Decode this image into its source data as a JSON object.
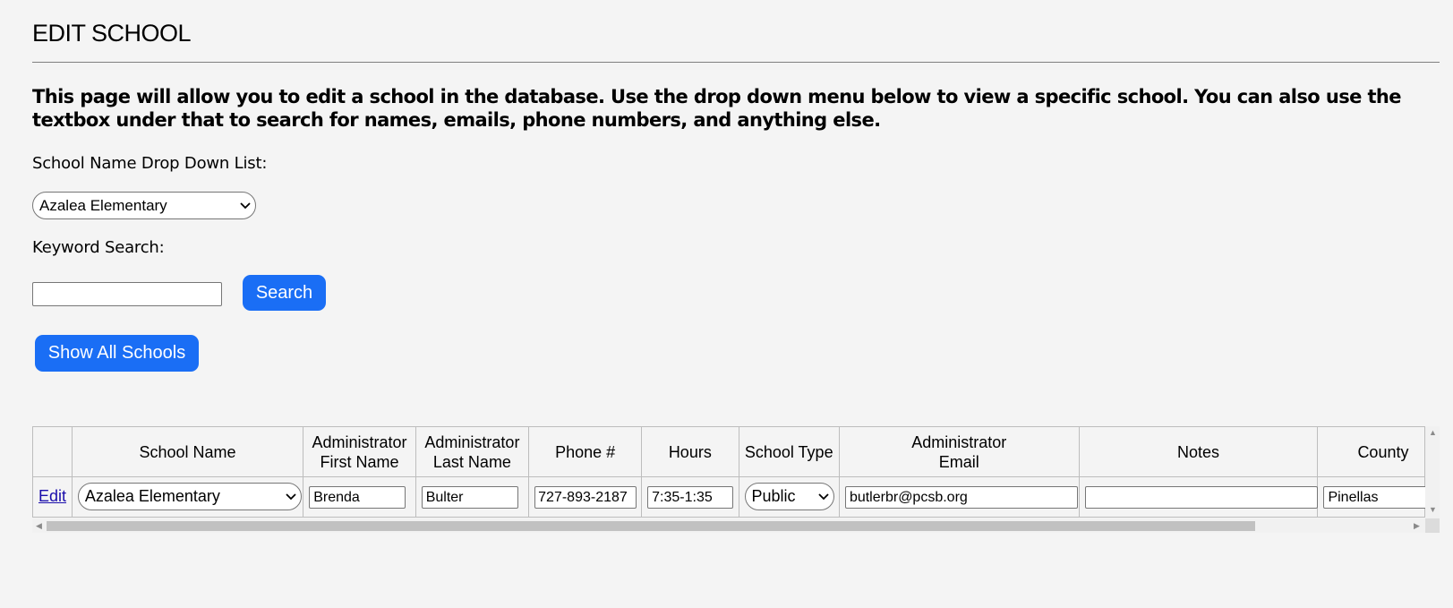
{
  "page": {
    "title": "EDIT SCHOOL",
    "intro": "This page will allow you to edit a school in the database. Use the drop down menu below to view a specific school. You can also use the textbox under that to search for names, emails, phone numbers, and anything else."
  },
  "filters": {
    "school_dropdown_label": "School Name Drop Down List:",
    "school_dropdown_value": "Azalea Elementary",
    "keyword_label": "Keyword Search:",
    "keyword_value": "",
    "search_button": "Search",
    "show_all_button": "Show All Schools"
  },
  "table": {
    "headers": {
      "edit": "",
      "school_name": "School Name",
      "admin_first_1": "Administrator",
      "admin_first_2": "First Name",
      "admin_last_1": "Administrator",
      "admin_last_2": "Last Name",
      "phone": "Phone #",
      "hours": "Hours",
      "school_type": "School Type",
      "admin_email_1": "Administrator",
      "admin_email_2": "Email",
      "notes": "Notes",
      "county": "County"
    },
    "row": {
      "edit_link": "Edit",
      "school_name": "Azalea Elementary",
      "admin_first": "Brenda",
      "admin_last": "Bulter",
      "phone": "727-893-2187",
      "hours": "7:35-1:35",
      "school_type": "Public",
      "admin_email": "butlerbr@pcsb.org",
      "notes": "",
      "county": "Pinellas"
    }
  },
  "colors": {
    "button_blue": "#1a6ef5",
    "link_blue": "#1a0dab",
    "background": "#f4f4f4"
  }
}
